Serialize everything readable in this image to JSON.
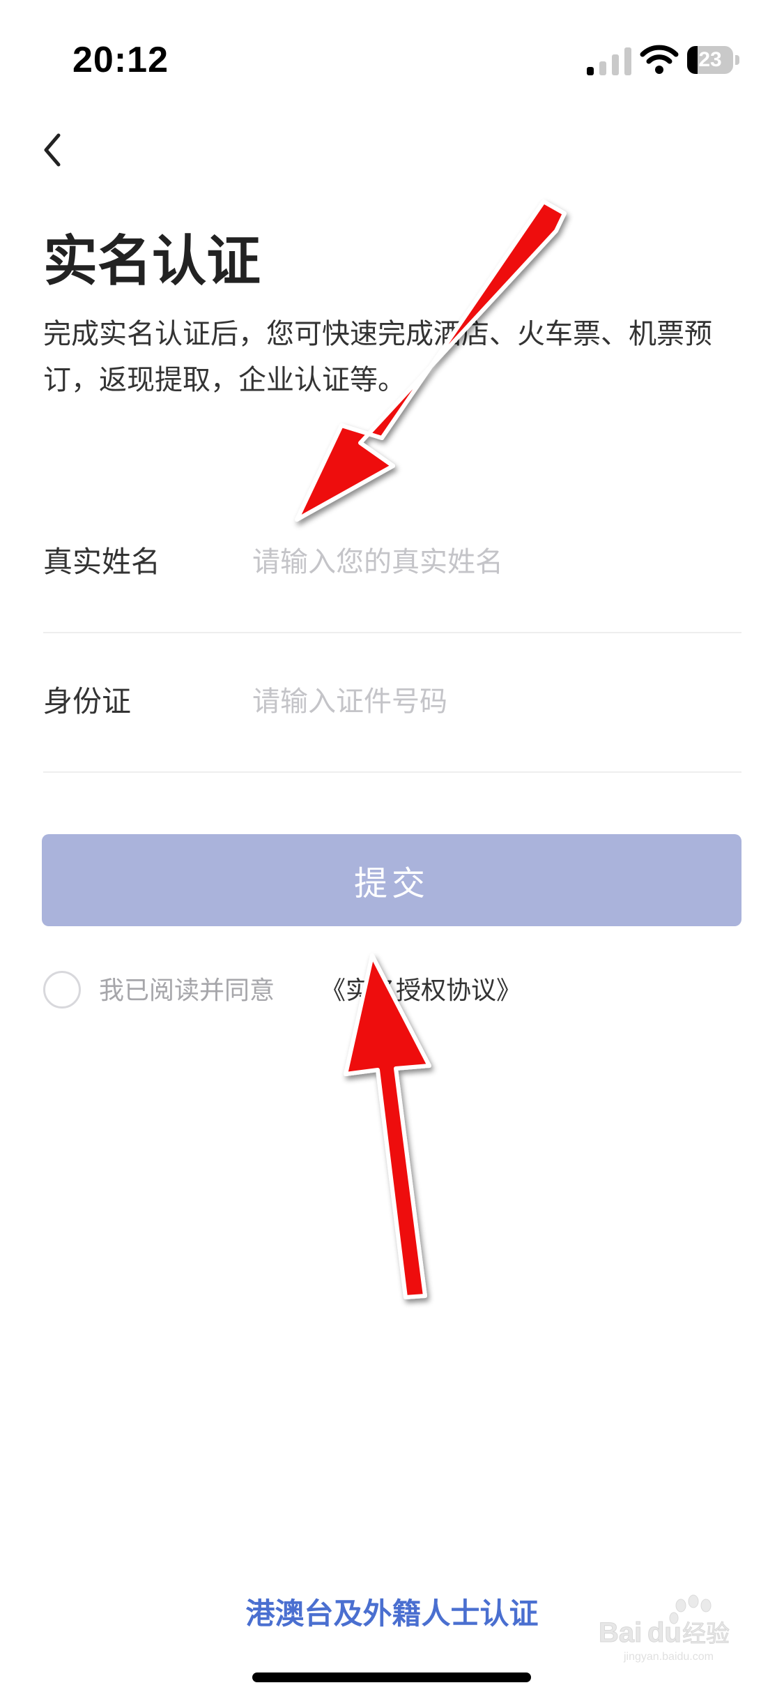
{
  "status_bar": {
    "time": "20:12",
    "battery_level": "23",
    "battery_fraction": 0.23,
    "signal_icon": "cellular-signal-icon",
    "wifi_icon": "wifi-icon"
  },
  "nav": {
    "back_icon": "chevron-left-icon"
  },
  "page": {
    "title": "实名认证",
    "description": "完成实名认证后，您可快速完成酒店、火车票、机票预订，返现提取，企业认证等。"
  },
  "form": {
    "name_label": "真实姓名",
    "name_placeholder": "请输入您的真实姓名",
    "id_label": "身份证",
    "id_placeholder": "请输入证件号码"
  },
  "submit": {
    "label": "提交"
  },
  "agreement": {
    "text": "我已阅读并同意",
    "link": "《实名授权协议》"
  },
  "footer": {
    "foreign_link": "港澳台及外籍人士认证"
  },
  "watermark": {
    "text": "Baidu经验",
    "subtext": "jingyan.baidu.com"
  },
  "colors": {
    "submit_bg": "#aab3db",
    "link_blue": "#4a6fd0",
    "annotation_red": "#ee1111"
  }
}
